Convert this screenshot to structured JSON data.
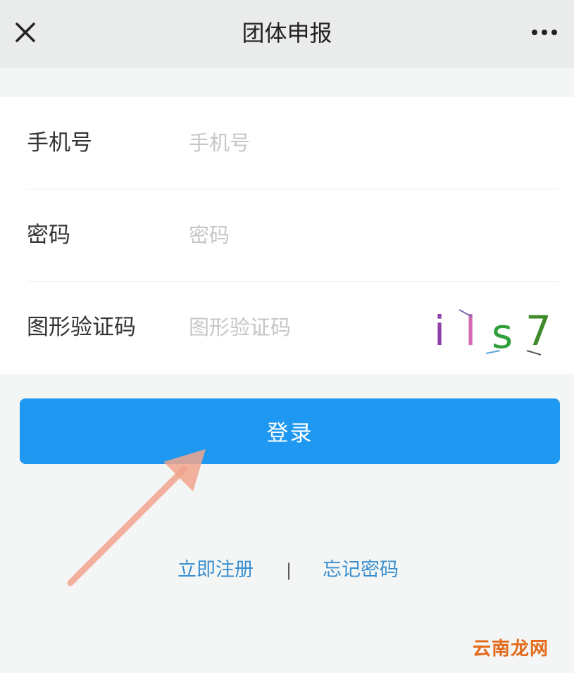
{
  "header": {
    "title": "团体申报",
    "close_icon": "close-icon",
    "more_icon": "more-dots-icon"
  },
  "form": {
    "phone": {
      "label": "手机号",
      "placeholder": "手机号",
      "value": ""
    },
    "password": {
      "label": "密码",
      "placeholder": "密码",
      "value": ""
    },
    "captcha": {
      "label": "图形验证码",
      "placeholder": "图形验证码",
      "value": "",
      "image_text": [
        "i",
        "l",
        "s",
        "7"
      ],
      "image_colors": [
        "#8e3fa8",
        "#d46bb4",
        "#2f9f3a",
        "#3f8a2a"
      ]
    }
  },
  "login_button": {
    "label": "登录",
    "color": "#1e98f0"
  },
  "links": {
    "register": "立即注册",
    "separator": "|",
    "forgot": "忘记密码"
  },
  "watermark": "云南龙网",
  "colors": {
    "accent": "#1e98f0",
    "link": "#3a8fd0",
    "arrow": "#f0a48c"
  }
}
